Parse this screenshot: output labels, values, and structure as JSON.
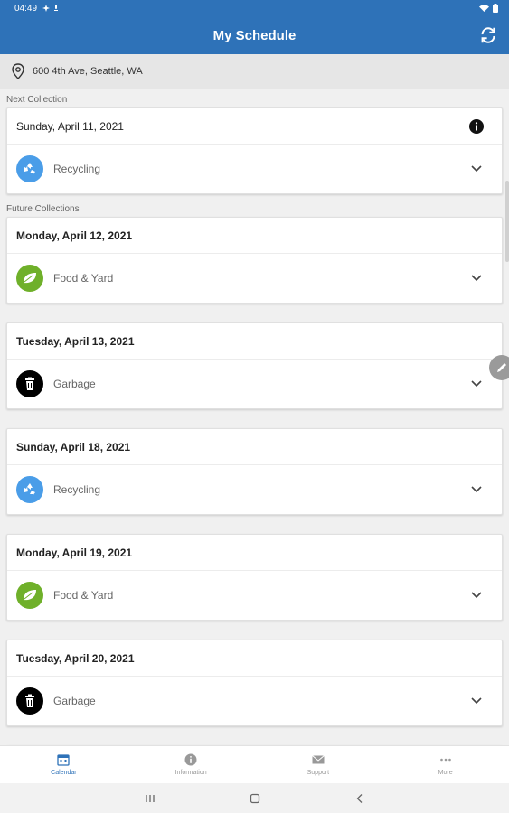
{
  "status_bar": {
    "time": "04:49"
  },
  "app_bar": {
    "title": "My Schedule"
  },
  "address": "600 4th Ave, Seattle, WA",
  "next_section_label": "Next Collection",
  "future_section_label": "Future Collections",
  "next_collection": {
    "date": "Sunday, April 11, 2021",
    "type": "Recycling",
    "icon": "recycle-icon"
  },
  "future_collections": [
    {
      "date": "Monday, April 12, 2021",
      "type": "Food & Yard",
      "icon": "leaf-icon"
    },
    {
      "date": "Tuesday, April 13, 2021",
      "type": "Garbage",
      "icon": "trash-icon"
    },
    {
      "date": "Sunday, April 18, 2021",
      "type": "Recycling",
      "icon": "recycle-icon"
    },
    {
      "date": "Monday, April 19, 2021",
      "type": "Food & Yard",
      "icon": "leaf-icon"
    },
    {
      "date": "Tuesday, April 20, 2021",
      "type": "Garbage",
      "icon": "trash-icon"
    }
  ],
  "bottom_nav": [
    {
      "label": "Calendar",
      "icon": "calendar-icon",
      "active": true
    },
    {
      "label": "Information",
      "icon": "info-icon",
      "active": false
    },
    {
      "label": "Support",
      "icon": "mail-icon",
      "active": false
    },
    {
      "label": "More",
      "icon": "more-icon",
      "active": false
    }
  ],
  "colors": {
    "primary": "#2e72b8",
    "recycling": "#4a9de8",
    "food_yard": "#6fb02a",
    "garbage": "#000000"
  }
}
